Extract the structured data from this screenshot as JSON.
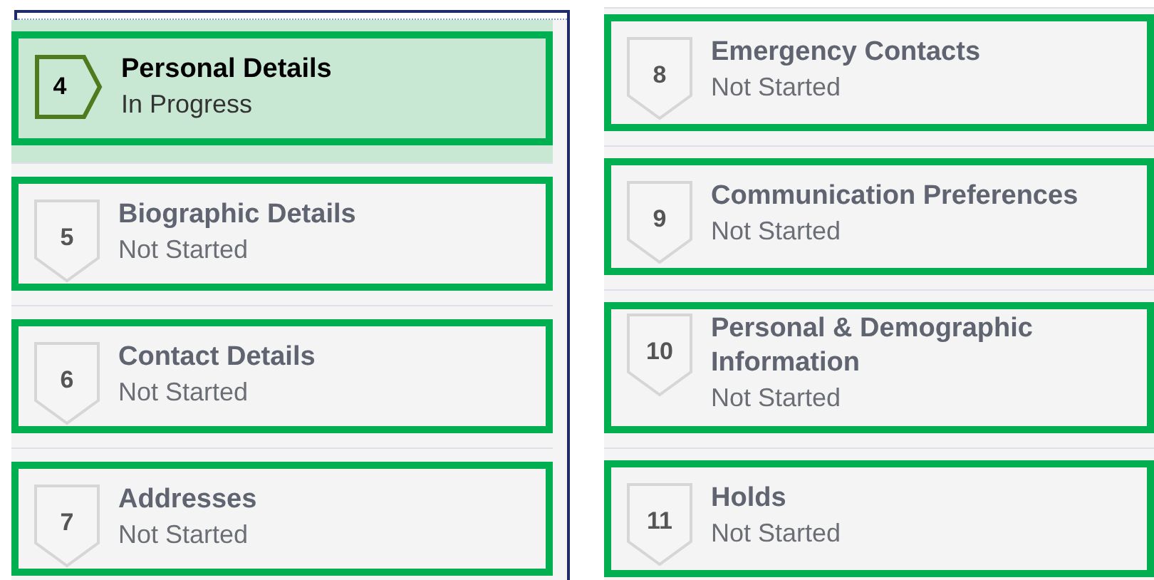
{
  "columns": [
    {
      "steps": [
        {
          "number": "4",
          "title": "Personal Details",
          "status": "In Progress",
          "selected": true
        },
        {
          "number": "5",
          "title": "Biographic Details",
          "status": "Not Started",
          "selected": false
        },
        {
          "number": "6",
          "title": "Contact Details",
          "status": "Not Started",
          "selected": false
        },
        {
          "number": "7",
          "title": "Addresses",
          "status": "Not Started",
          "selected": false
        }
      ]
    },
    {
      "steps": [
        {
          "number": "8",
          "title": "Emergency Contacts",
          "status": "Not Started",
          "selected": false
        },
        {
          "number": "9",
          "title": "Communication Preferences",
          "status": "Not Started",
          "selected": false
        },
        {
          "number": "10",
          "title": "Personal & Demographic Information",
          "status": "Not Started",
          "selected": false
        },
        {
          "number": "11",
          "title": "Holds",
          "status": "Not Started",
          "selected": false
        }
      ]
    }
  ]
}
